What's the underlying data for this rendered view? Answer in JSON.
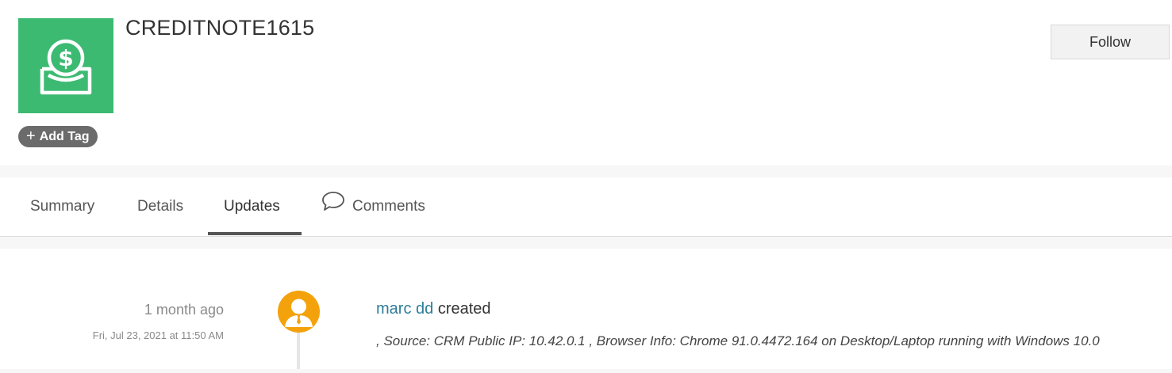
{
  "record": {
    "title": "CREDITNOTE1615",
    "icon": "dollar-coin-tray-icon",
    "icon_color": "#3dba72"
  },
  "actions": {
    "add_tag_label": "Add Tag",
    "follow_label": "Follow"
  },
  "tabs": [
    {
      "label": "Summary",
      "active": false
    },
    {
      "label": "Details",
      "active": false
    },
    {
      "label": "Updates",
      "active": true
    },
    {
      "label": "Comments",
      "active": false,
      "icon": "speech-bubble-icon"
    }
  ],
  "updates": [
    {
      "relative_time": "1 month ago",
      "timestamp": "Fri, Jul 23, 2021 at 11:50 AM",
      "user": "marc dd",
      "action": "created",
      "avatar_color": "#f4a20c",
      "detail": ", Source: CRM Public IP: 10.42.0.1 , Browser Info: Chrome 91.0.4472.164 on Desktop/Laptop running with Windows 10.0"
    }
  ]
}
